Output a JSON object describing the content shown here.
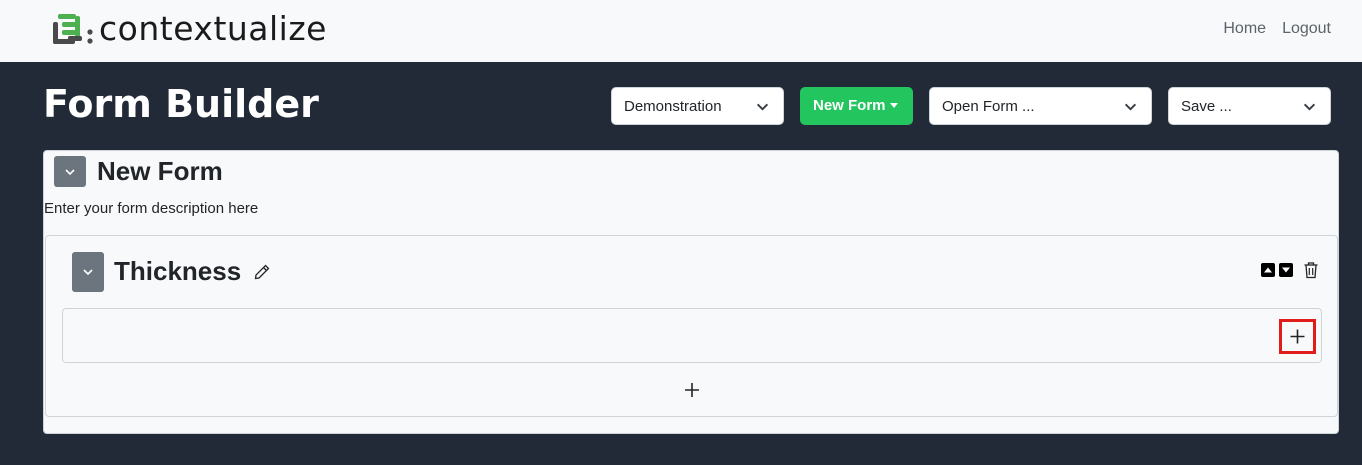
{
  "brand": "contextualize",
  "nav": {
    "home": "Home",
    "logout": "Logout"
  },
  "page_title": "Form Builder",
  "toolbar": {
    "project_select": "Demonstration",
    "new_form": "New Form",
    "open_form": "Open Form ...",
    "save": "Save ..."
  },
  "form": {
    "title": "New Form",
    "description": "Enter your form description here",
    "section": {
      "title": "Thickness"
    }
  },
  "colors": {
    "accent_green": "#22c55e",
    "dark_bg": "#212a36",
    "highlight": "#e21b1b"
  }
}
